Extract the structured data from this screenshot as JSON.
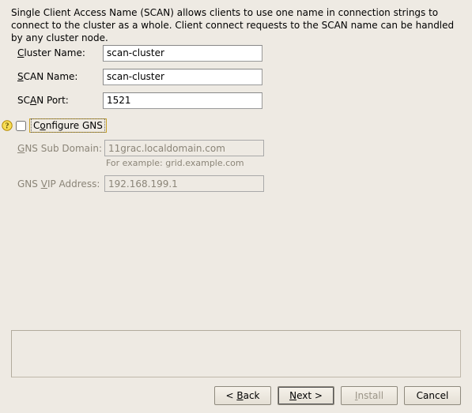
{
  "intro": "Single Client Access Name (SCAN) allows clients to use one name in connection strings to connect to the cluster as a whole. Client connect requests to the SCAN name can be handled by any cluster node.",
  "labels": {
    "cluster_pre": "",
    "cluster_u": "C",
    "cluster_post": "luster Name:",
    "scan_name_pre": "",
    "scan_name_u": "S",
    "scan_name_post": "CAN Name:",
    "scan_port_pre": "SC",
    "scan_port_u": "A",
    "scan_port_post": "N Port:",
    "configure_pre": "C",
    "configure_u": "o",
    "configure_post": "nfigure GNS",
    "gns_sub_pre": "",
    "gns_sub_u": "G",
    "gns_sub_post": "NS Sub Domain:",
    "gns_sub_hint": "For example: grid.example.com",
    "gns_vip_pre": "GNS ",
    "gns_vip_u": "V",
    "gns_vip_post": "IP Address:"
  },
  "values": {
    "cluster_name": "scan-cluster",
    "scan_name": "scan-cluster",
    "scan_port": "1521",
    "configure_gns_checked": false,
    "gns_sub_domain": "11grac.localdomain.com",
    "gns_vip": "192.168.199.1"
  },
  "buttons": {
    "back_pre": "< ",
    "back_u": "B",
    "back_post": "ack",
    "next_pre": "",
    "next_u": "N",
    "next_post": "ext >",
    "install_pre": "",
    "install_u": "I",
    "install_post": "nstall",
    "cancel": "Cancel"
  }
}
